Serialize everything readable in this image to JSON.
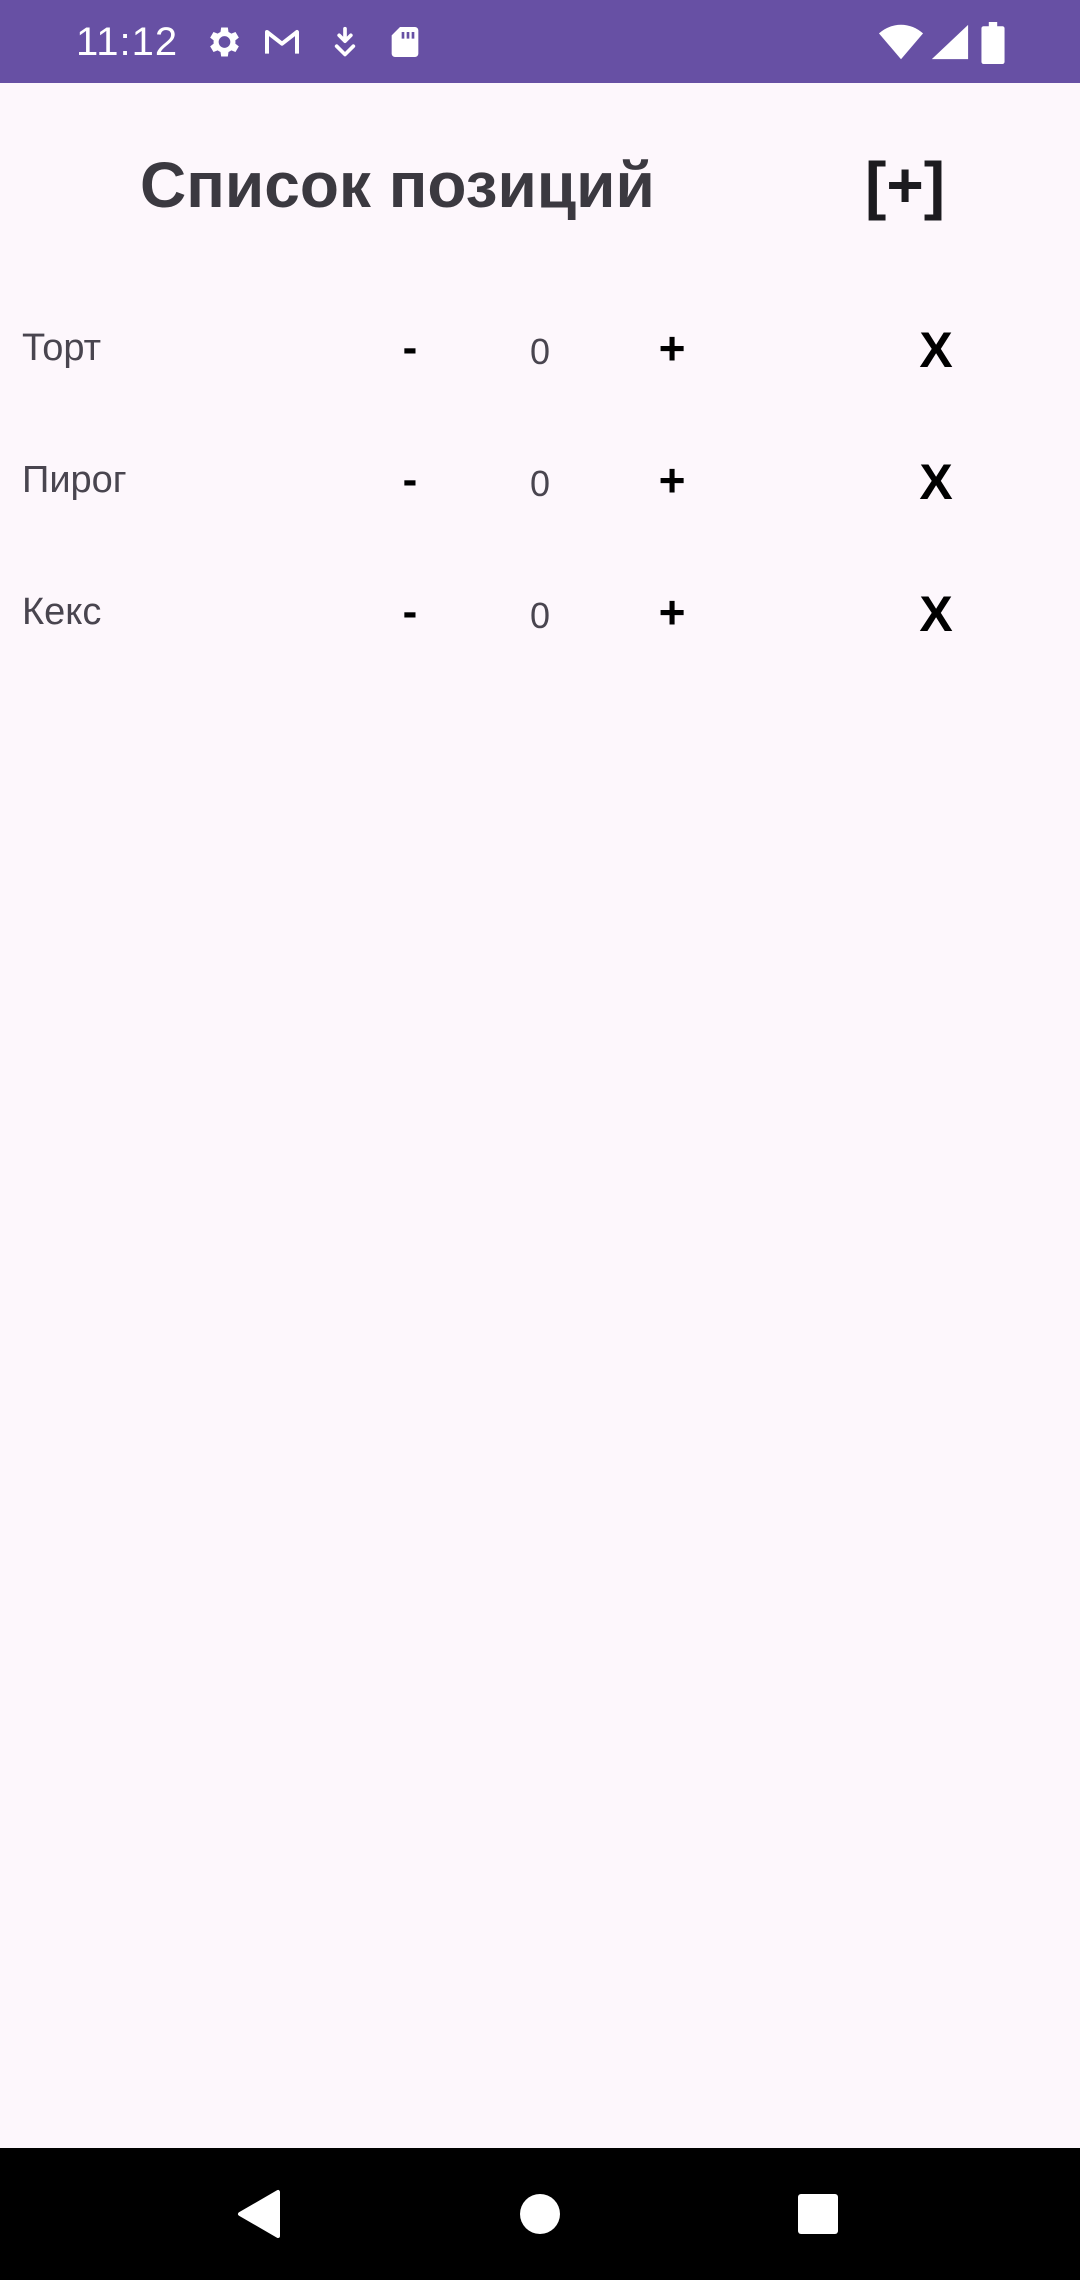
{
  "status_bar": {
    "time": "11:12",
    "icons_left": [
      "gear-icon",
      "gmail-icon",
      "download-icon",
      "sd-card-icon"
    ],
    "icons_right": [
      "wifi-icon",
      "signal-icon",
      "battery-icon"
    ],
    "background": "#6750a4"
  },
  "header": {
    "title": "Список позиций",
    "add_label": "[+]"
  },
  "rows": [
    {
      "name": "Торт",
      "minus": "-",
      "qty": "0",
      "plus": "+",
      "delete": "X"
    },
    {
      "name": "Пирог",
      "minus": "-",
      "qty": "0",
      "plus": "+",
      "delete": "X"
    },
    {
      "name": "Кекс",
      "minus": "-",
      "qty": "0",
      "plus": "+",
      "delete": "X"
    }
  ],
  "nav_bar": {
    "buttons": [
      "back-icon",
      "home-icon",
      "recents-icon"
    ]
  }
}
